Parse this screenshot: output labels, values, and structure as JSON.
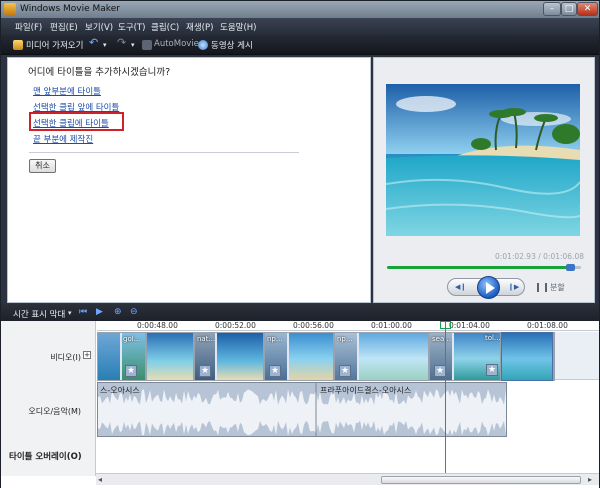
{
  "window": {
    "title": "Windows Movie Maker"
  },
  "menu": [
    "파일(F)",
    "편집(E)",
    "보기(V)",
    "도구(T)",
    "클립(C)",
    "재생(P)",
    "도움말(H)"
  ],
  "toolbar": {
    "import_label": "미디어 가져오기",
    "automovie_label": "AutoMovie",
    "publish_label": "동영상 게시"
  },
  "task_pane": {
    "title": "어디에 타이틀을 추가하시겠습니까?",
    "links": [
      "맨 앞부분에 타이틀",
      "선택한 클립 앞에 타이틀",
      "선택한 클립에 타이틀",
      "끝 부분에 제작진"
    ],
    "cancel_label": "취소"
  },
  "preview": {
    "time": "0:01:02.93 / 0:01:06.08",
    "progress": 0.95,
    "split_label": "분할"
  },
  "timeline": {
    "view_label": "시간 표시 막대",
    "ruler": [
      "0:00:48.00",
      "0:00:52.00",
      "0:00:56.00",
      "0:01:00.00",
      "0:01:04.00",
      "0:01:08.00"
    ],
    "tracks": {
      "video": "비디오(I)",
      "audio": "오디오/음악(M)",
      "overlay": "타이틀 오버레이(O)"
    },
    "clips": [
      "gol...",
      "nat...",
      "np...",
      "np...",
      "sea...",
      "tol..."
    ],
    "audio_clips": [
      "스-오아시스",
      "프라푸아이드결스-오아시스"
    ]
  }
}
